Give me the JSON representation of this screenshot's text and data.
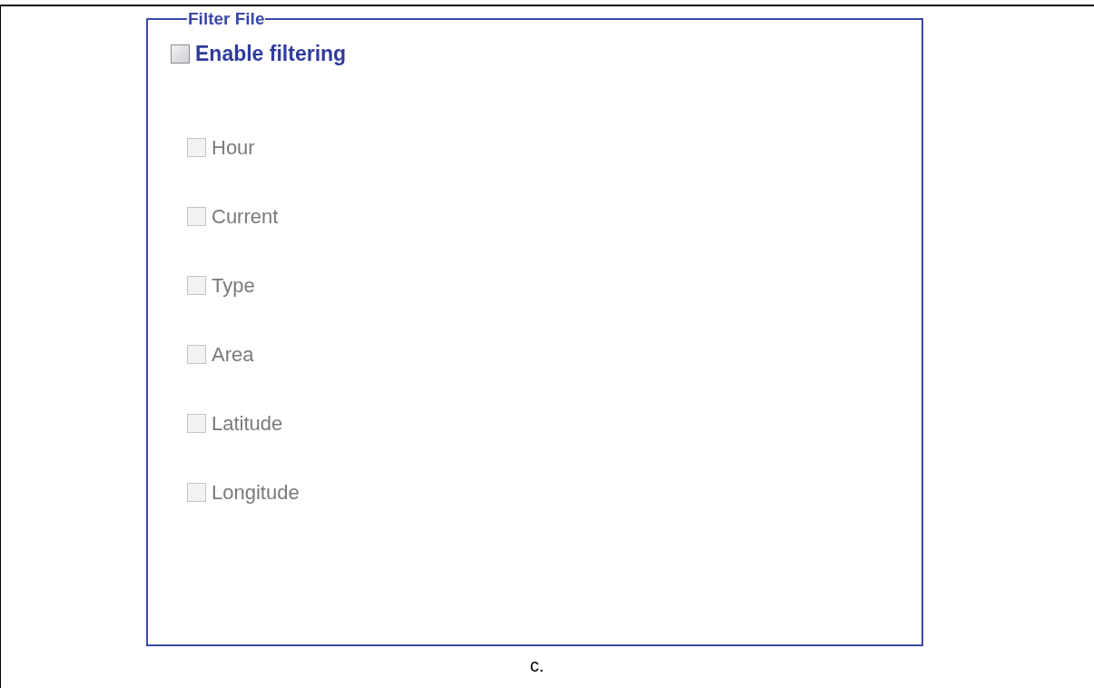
{
  "fieldset": {
    "legend": "Filter File",
    "enable": {
      "label": "Enable filtering",
      "checked": false
    },
    "fields": [
      {
        "label": "Hour",
        "checked": false,
        "disabled": true
      },
      {
        "label": "Current",
        "checked": false,
        "disabled": true
      },
      {
        "label": "Type",
        "checked": false,
        "disabled": true
      },
      {
        "label": "Area",
        "checked": false,
        "disabled": true
      },
      {
        "label": "Latitude",
        "checked": false,
        "disabled": true
      },
      {
        "label": "Longitude",
        "checked": false,
        "disabled": true
      }
    ]
  },
  "caption": "c."
}
